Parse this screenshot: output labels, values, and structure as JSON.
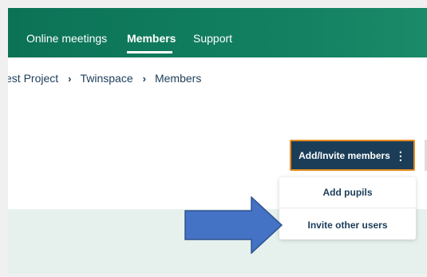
{
  "nav": {
    "items": [
      {
        "label": "Online meetings",
        "active": false
      },
      {
        "label": "Members",
        "active": true
      },
      {
        "label": "Support",
        "active": false
      }
    ]
  },
  "breadcrumb": {
    "items": [
      "Test Project",
      "Twinspace",
      "Members"
    ],
    "separator": "›"
  },
  "actions": {
    "invite_button_label": "Add/Invite members",
    "invite_button_icon": "⋮",
    "menu": {
      "items": [
        "Add pupils",
        "Invite other users"
      ]
    }
  },
  "colors": {
    "nav_bg": "#0c7256",
    "button_bg": "#1b3d57",
    "button_border": "#e68a1f",
    "arrow_fill": "#4472c4",
    "arrow_stroke": "#2f528f",
    "band_bg": "#e6f1ed"
  },
  "annotation": {
    "icon": "blue-right-arrow-icon"
  }
}
